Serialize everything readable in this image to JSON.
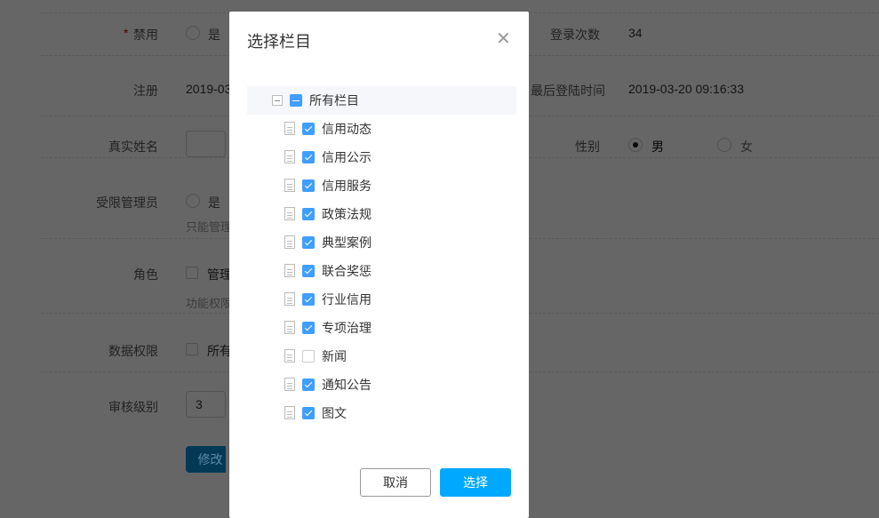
{
  "form": {
    "disabled": {
      "label": "禁用",
      "required_mark": "*",
      "option_yes": "是"
    },
    "register": {
      "label": "注册",
      "value": "2019-03"
    },
    "real_name": {
      "label": "真实姓名",
      "value": ""
    },
    "limited_admin": {
      "label": "受限管理员",
      "option_yes": "是",
      "hint": "只能管理"
    },
    "role": {
      "label": "角色",
      "option": "管理",
      "hint": "功能权限"
    },
    "data_perm": {
      "label": "数据权限",
      "option": "所有"
    },
    "review_level": {
      "label": "审核级别",
      "value": "3"
    },
    "submit_label": "修改",
    "login_count": {
      "label": "登录次数",
      "value": "34"
    },
    "last_login": {
      "label": "最后登陆时间",
      "value": "2019-03-20 09:16:33"
    },
    "gender": {
      "label": "性别",
      "male": "男",
      "female": "女",
      "selected": "男"
    }
  },
  "dialog": {
    "title": "选择栏目",
    "close_icon": "close-icon",
    "root": {
      "label": "所有栏目",
      "state": "indeterminate",
      "expanded": true
    },
    "children": [
      {
        "label": "信用动态",
        "checked": true
      },
      {
        "label": "信用公示",
        "checked": true
      },
      {
        "label": "信用服务",
        "checked": true
      },
      {
        "label": "政策法规",
        "checked": true
      },
      {
        "label": "典型案例",
        "checked": true
      },
      {
        "label": "联合奖惩",
        "checked": true
      },
      {
        "label": "行业信用",
        "checked": true
      },
      {
        "label": "专项治理",
        "checked": true
      },
      {
        "label": "新闻",
        "checked": false
      },
      {
        "label": "通知公告",
        "checked": true
      },
      {
        "label": "图文",
        "checked": true
      }
    ],
    "cancel_label": "取消",
    "confirm_label": "选择"
  },
  "colors": {
    "primary": "#409eff",
    "confirm": "#00a8ff",
    "submit": "#0a8fd6"
  }
}
